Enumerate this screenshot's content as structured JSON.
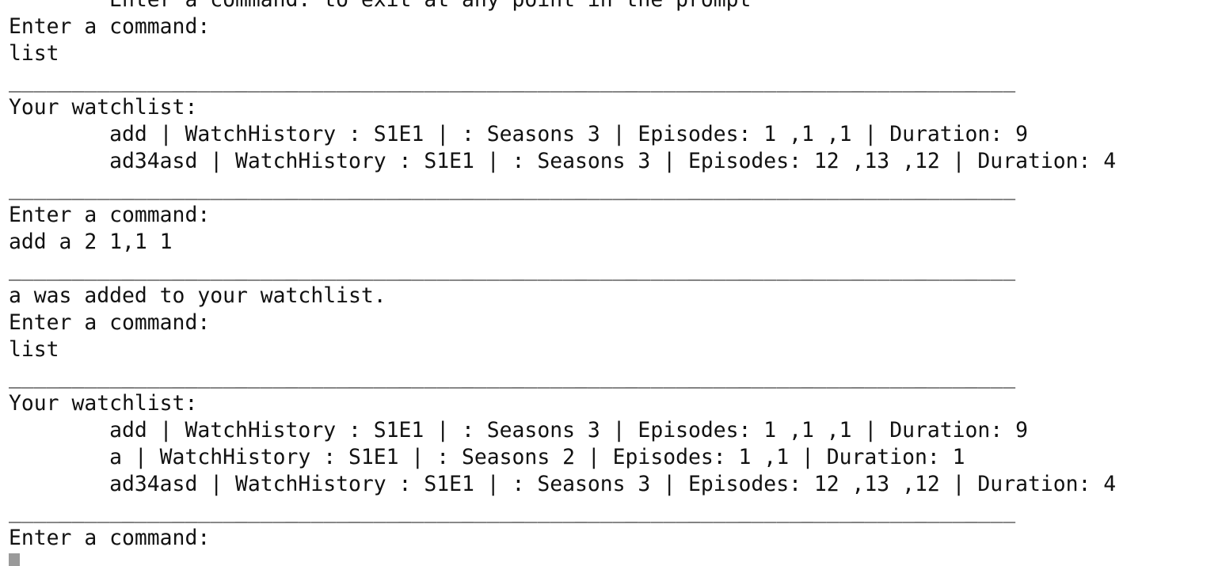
{
  "terminal": {
    "lines": [
      "        Enter a command: to exit at any point in the prompt",
      "Enter a command:",
      "list",
      "________________________________________________________________________________",
      "Your watchlist:",
      "        add | WatchHistory : S1E1 | : Seasons 3 | Episodes: 1 ,1 ,1 | Duration: 9",
      "        ad34asd | WatchHistory : S1E1 | : Seasons 3 | Episodes: 12 ,13 ,12 | Duration: 4",
      "________________________________________________________________________________",
      "Enter a command:",
      "add a 2 1,1 1",
      "________________________________________________________________________________",
      "a was added to your watchlist.",
      "Enter a command:",
      "list",
      "________________________________________________________________________________",
      "Your watchlist:",
      "        add | WatchHistory : S1E1 | : Seasons 3 | Episodes: 1 ,1 ,1 | Duration: 9",
      "        a | WatchHistory : S1E1 | : Seasons 2 | Episodes: 1 ,1 | Duration: 1",
      "        ad34asd | WatchHistory : S1E1 | : Seasons 3 | Episodes: 12 ,13 ,12 | Duration: 4",
      "________________________________________________________________________________",
      "Enter a command:"
    ]
  }
}
